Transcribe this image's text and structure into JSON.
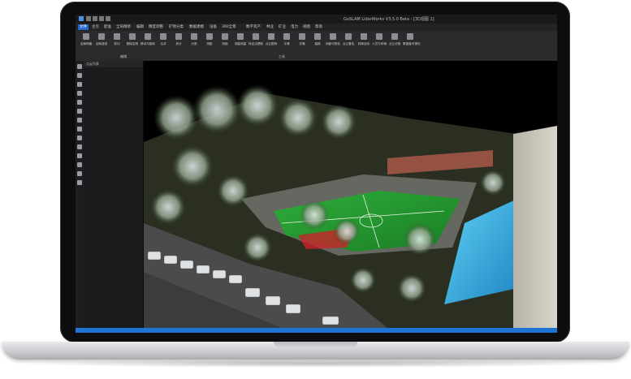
{
  "window": {
    "title": "GoSLAM LidarWorks V3.5.0 Beta - [3D视图 1]"
  },
  "menu": {
    "items": [
      {
        "label": "文件",
        "active": true
      },
      {
        "label": "主页",
        "active": false
      },
      {
        "label": "配准",
        "active": false
      },
      {
        "label": "全局精修",
        "active": false
      },
      {
        "label": "编辑",
        "active": false
      },
      {
        "label": "精度调整",
        "active": false
      },
      {
        "label": "矿物分类",
        "active": false
      },
      {
        "label": "数据建模",
        "active": false
      },
      {
        "label": "设备",
        "active": false
      },
      {
        "label": "360全景",
        "active": false
      },
      {
        "label": "数字资产",
        "active": false
      },
      {
        "label": "林业",
        "active": false
      },
      {
        "label": "矿业",
        "active": false
      },
      {
        "label": "电力",
        "active": false
      },
      {
        "label": "视图",
        "active": false
      },
      {
        "label": "帮助",
        "active": false
      }
    ]
  },
  "ribbon": {
    "tools": [
      {
        "label": "全局网格",
        "icon": "grid-icon"
      },
      {
        "label": "全局漫游",
        "icon": "roam-icon"
      },
      {
        "label": "剪切",
        "icon": "scissors-icon"
      },
      {
        "label": "删除结构",
        "icon": "delete-structure-icon"
      },
      {
        "label": "移动与旋转",
        "icon": "move-rotate-icon"
      },
      {
        "label": "合并",
        "icon": "merge-icon"
      },
      {
        "label": "拆分",
        "icon": "split-icon"
      },
      {
        "label": "分割",
        "icon": "segment-icon"
      },
      {
        "label": "测距",
        "icon": "measure-icon"
      },
      {
        "label": "测面",
        "icon": "area-icon"
      },
      {
        "label": "测量测量",
        "icon": "measure2-icon"
      },
      {
        "label": "特征点提取",
        "icon": "feature-point-icon"
      },
      {
        "label": "点云图例",
        "icon": "legend-icon"
      },
      {
        "label": "平滑",
        "icon": "smooth-icon"
      },
      {
        "label": "去噪",
        "icon": "denoise-icon"
      },
      {
        "label": "抽稀",
        "icon": "thin-icon"
      },
      {
        "label": "间距可视化",
        "icon": "spacing-icon"
      },
      {
        "label": "点云着色",
        "icon": "coloring-icon"
      },
      {
        "label": "转换坐标",
        "icon": "transform-icon"
      },
      {
        "label": "人员与车辆",
        "icon": "people-icon"
      },
      {
        "label": "点云分割",
        "icon": "cloud-split-icon"
      },
      {
        "label": "覆盖度可视化",
        "icon": "coverage-icon"
      }
    ],
    "group_left": "编辑",
    "group_right": "工具"
  },
  "panel": {
    "header": "点云列表"
  }
}
